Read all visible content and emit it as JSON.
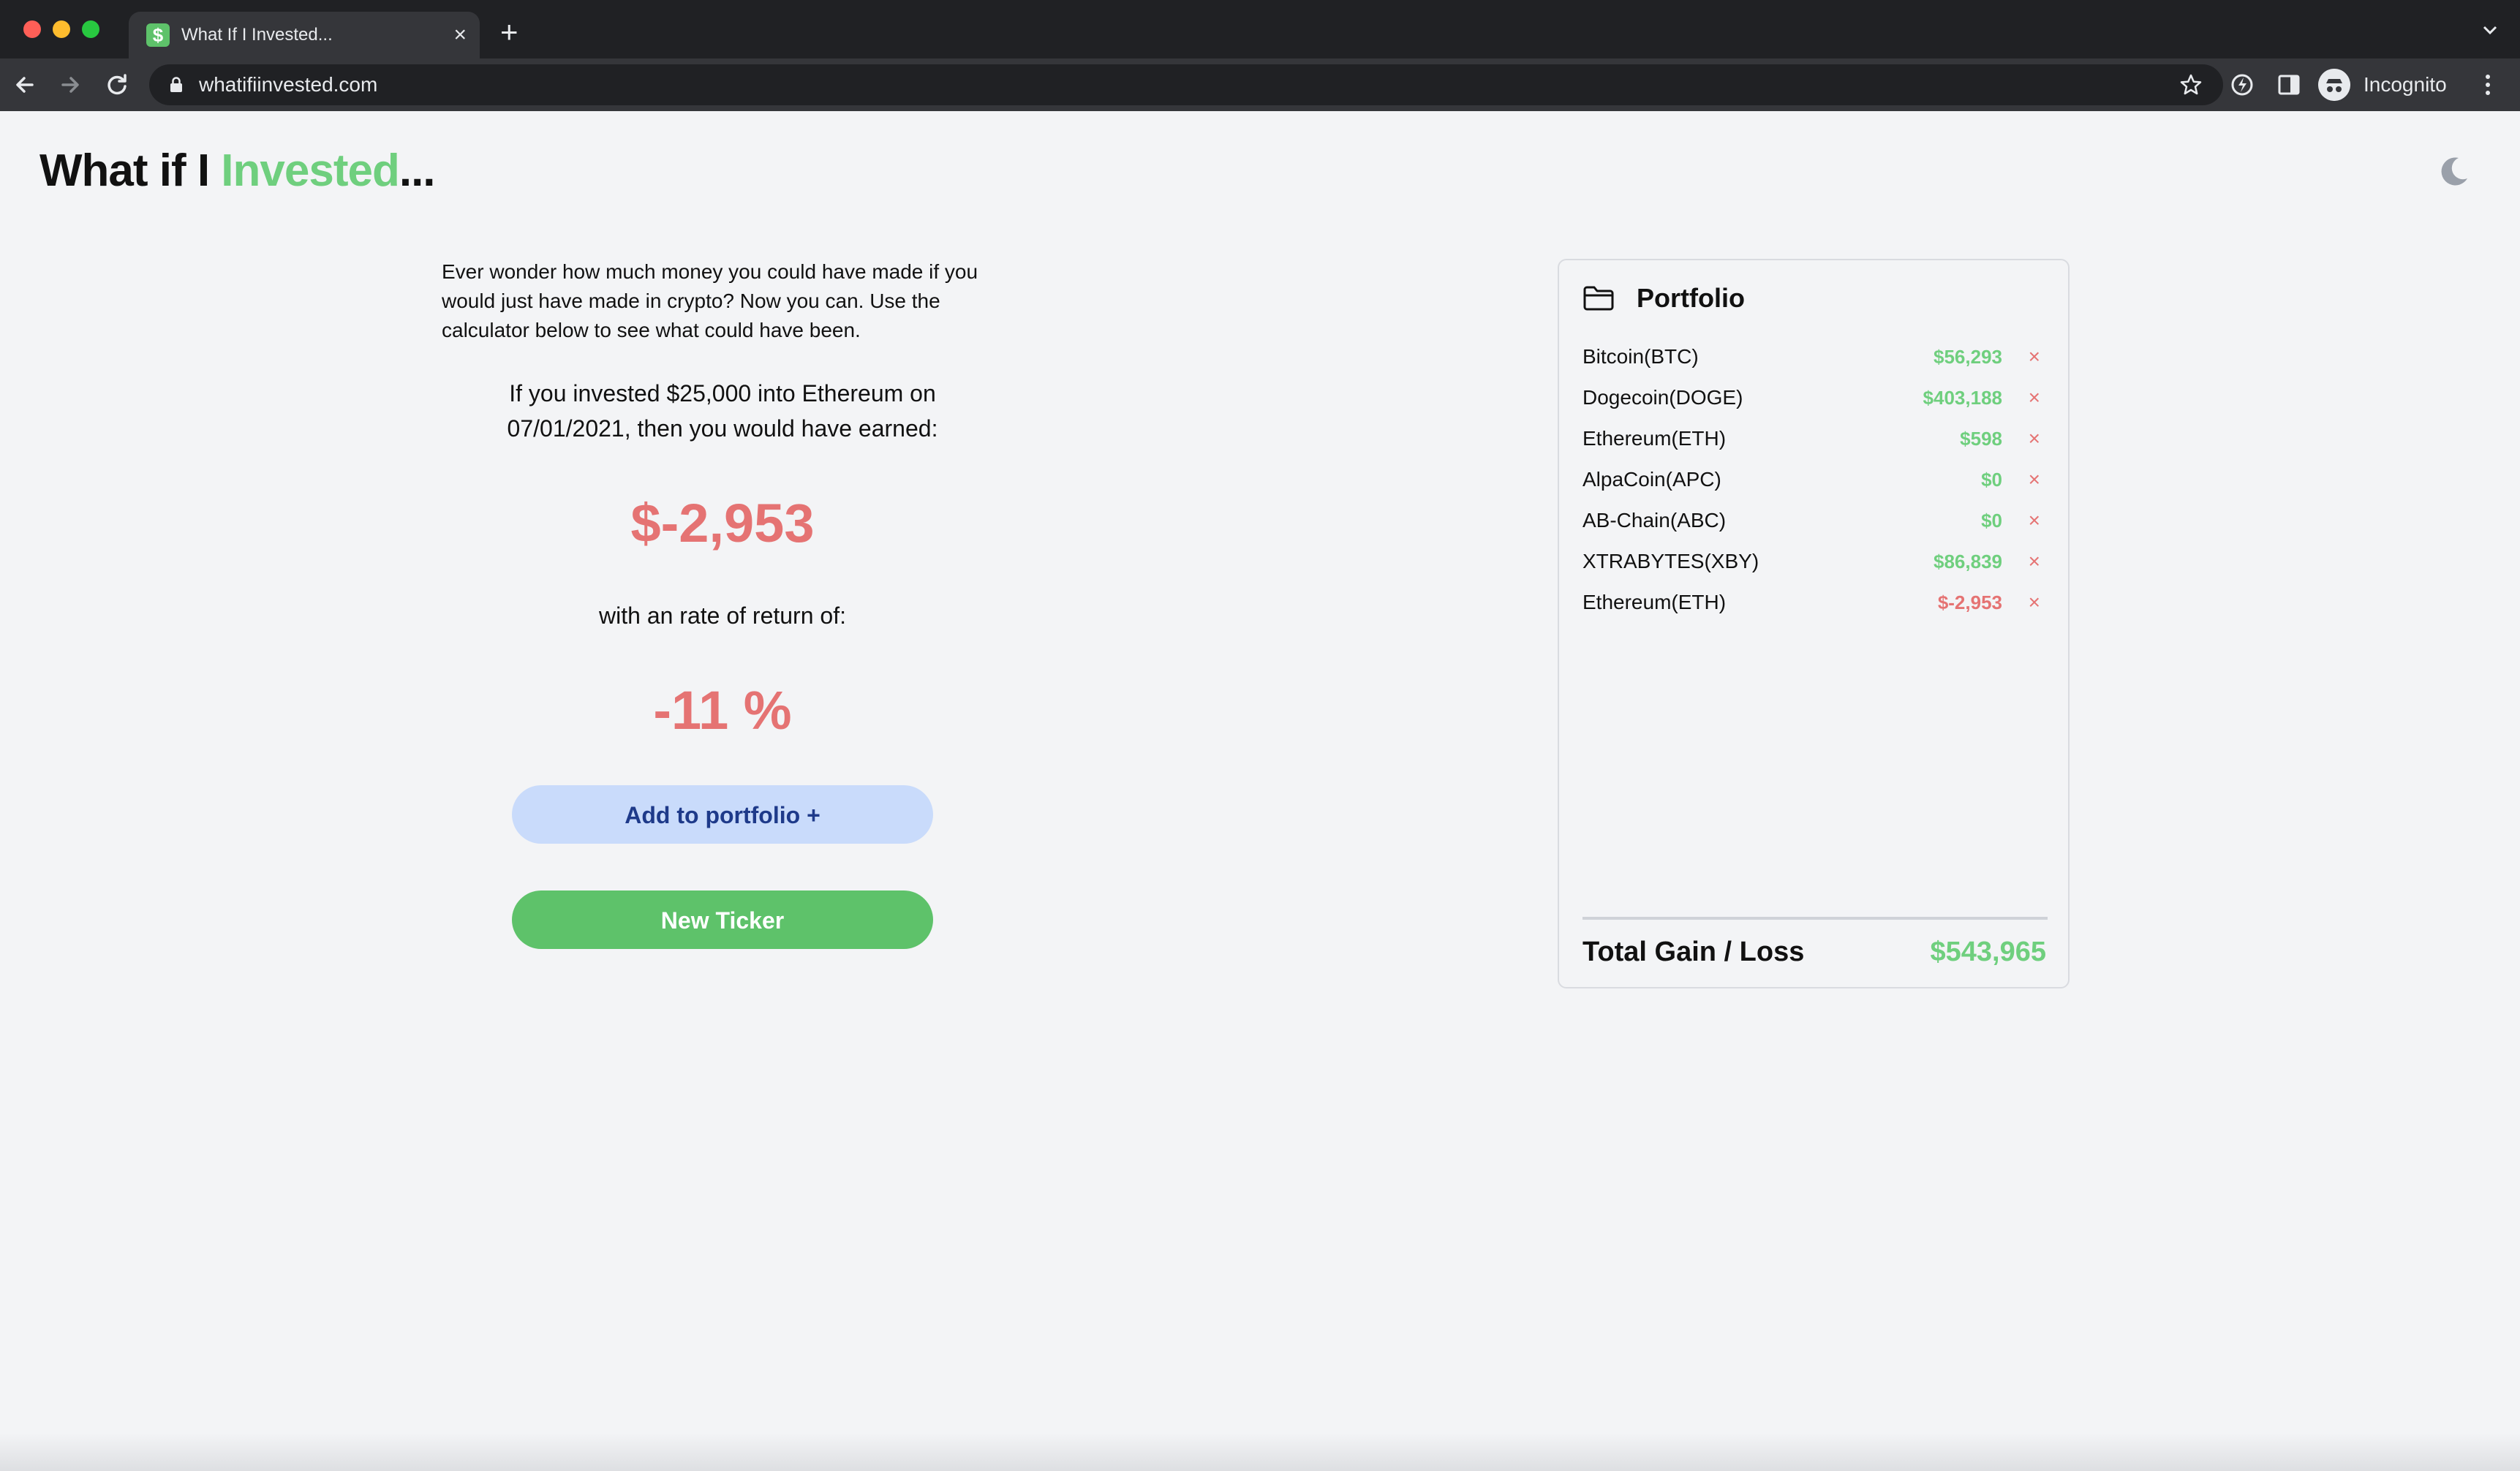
{
  "browser": {
    "tab_title": "What If I Invested...",
    "tab_favicon": "$",
    "tab_close": "×",
    "new_tab": "+",
    "url": "whatifiinvested.com",
    "profile_label": "Incognito"
  },
  "header": {
    "logo_part1": "What if I ",
    "logo_accent": "Invested",
    "logo_part2": "...",
    "accent_color": "#6fcf7e",
    "theme_toggle_icon": "moon-icon"
  },
  "calculator": {
    "intro": "Ever wonder how much money you could have made if you would just have made in crypto? Now you can. Use the calculator below to see what could have been.",
    "result_line1": "If you invested $25,000 into Ethereum on",
    "result_line2": "07/01/2021, then you would have earned:",
    "earned": "$-2,953",
    "rate_label": "with an rate of return of:",
    "rate_value": "-11 %",
    "add_button": "Add to portfolio +",
    "new_ticker_button": "New Ticker"
  },
  "portfolio": {
    "title": "Portfolio",
    "items": [
      {
        "name": "Bitcoin(BTC)",
        "value": "$56,293",
        "remove": "×"
      },
      {
        "name": "Dogecoin(DOGE)",
        "value": "$403,188",
        "remove": "×"
      },
      {
        "name": "Ethereum(ETH)",
        "value": "$598",
        "remove": "×"
      },
      {
        "name": "AlpaCoin(APC)",
        "value": "$0",
        "remove": "×"
      },
      {
        "name": "AB-Chain(ABC)",
        "value": "$0",
        "remove": "×"
      },
      {
        "name": "XTRABYTES(XBY)",
        "value": "$86,839",
        "remove": "×"
      },
      {
        "name": "Ethereum(ETH)",
        "value": "$-2,953",
        "remove": "×"
      }
    ],
    "total_label": "Total Gain / Loss",
    "total_value": "$543,965"
  },
  "colors": {
    "positive": "#6fcf7e",
    "negative": "#e57373",
    "add_button_bg": "#c9dbfb",
    "new_ticker_bg": "#5ec26a"
  }
}
